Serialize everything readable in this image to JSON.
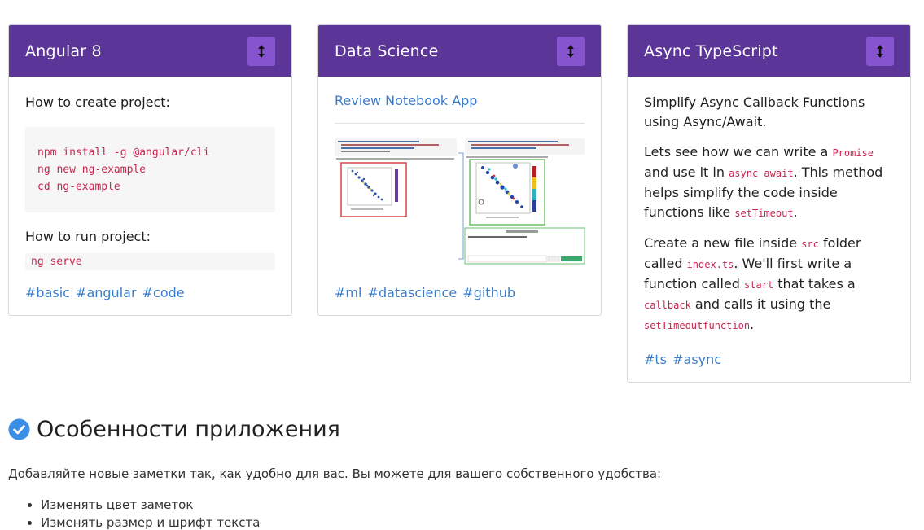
{
  "cards": [
    {
      "title": "Angular 8",
      "create_heading": "How to create project:",
      "create_code": "npm install -g @angular/cli\nng new ng-example\ncd ng-example",
      "run_heading": "How to run project:",
      "run_code": "ng serve",
      "tags": [
        "#basic",
        "#angular",
        "#code"
      ]
    },
    {
      "title": "Data Science",
      "link": "Review Notebook App",
      "tags": [
        "#ml",
        "#datascience",
        "#github"
      ]
    },
    {
      "title": "Async TypeScript",
      "heading": "Simplify Async Callback Functions using Async/Await.",
      "p1": {
        "t1": "Lets see how we can write a ",
        "c1": "Promise",
        "t2": " and use it in ",
        "c2": "async await",
        "t3": ". This method helps simplify the code inside functions like ",
        "c3": "setTimeout",
        "t4": "."
      },
      "p2": {
        "t1": "Create a new file inside ",
        "c1": "src",
        "t2": " folder called ",
        "c2": "index.ts",
        "t3": ". We'll first write a function called ",
        "c3": "start",
        "t4": " that takes a ",
        "c4": "callback",
        "t5": " and calls it using the ",
        "c5": "setTimeoutfunction",
        "t6": "."
      },
      "tags": [
        "#ts",
        "#async"
      ]
    }
  ],
  "toggle_icon": "up-down-arrow-icon",
  "colors": {
    "header_bg": "#5b3597",
    "toggle_bg": "#8654cf",
    "link": "#3a7cc8",
    "code": "#c7254e",
    "check": "#3a8ee6"
  },
  "features": {
    "title": "Особенности приложения",
    "description": "Добавляйте новые заметки так, как удобно для вас. Вы можете для вашего собственного удобства:",
    "items": [
      "Изменять цвет заметок",
      "Изменять размер и шрифт текста"
    ]
  }
}
